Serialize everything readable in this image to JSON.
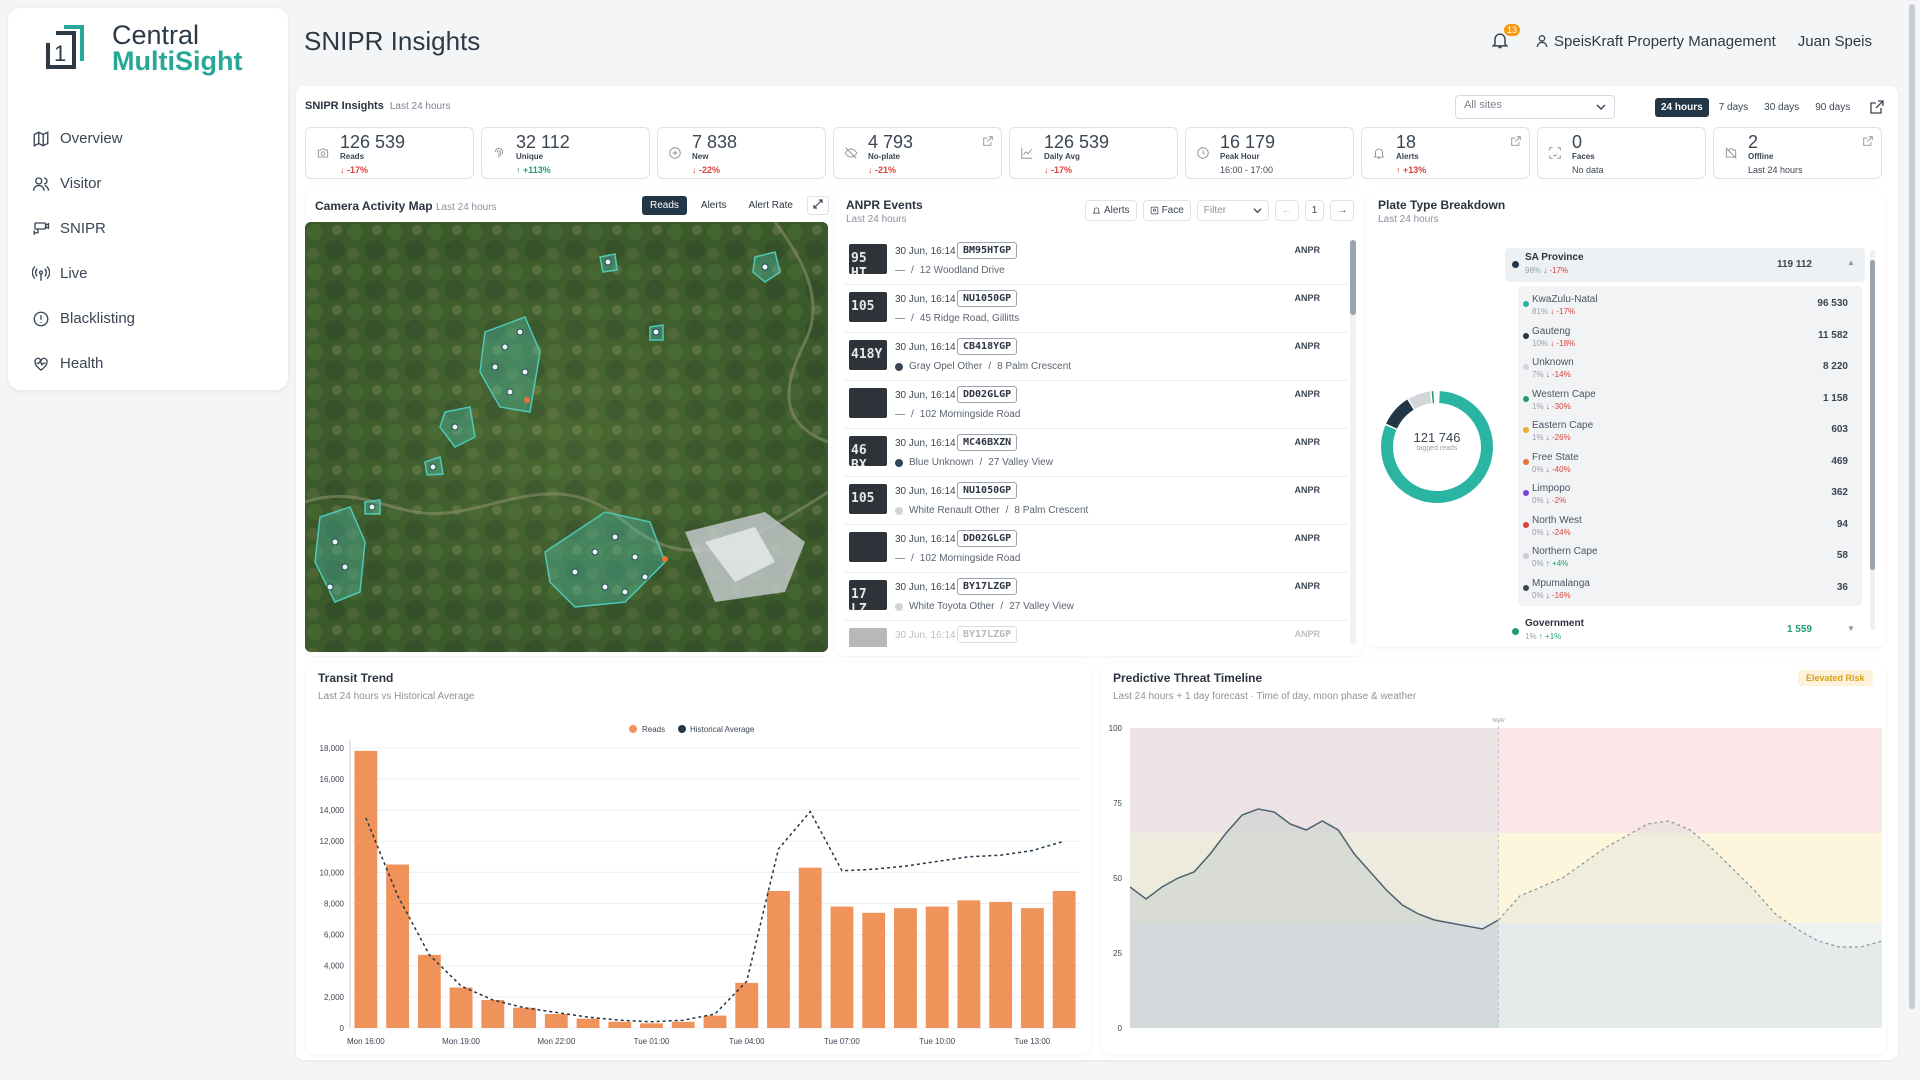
{
  "brand": {
    "line1": "Central",
    "line2": "MultiSight",
    "colors": {
      "teal": "#27a896",
      "dark": "#2d3a46"
    }
  },
  "nav": [
    {
      "label": "Overview",
      "icon": "map-icon"
    },
    {
      "label": "Visitor",
      "icon": "users-icon"
    },
    {
      "label": "SNIPR",
      "icon": "camera-icon"
    },
    {
      "label": "Live",
      "icon": "broadcast-icon"
    },
    {
      "label": "Blacklisting",
      "icon": "info-icon"
    },
    {
      "label": "Health",
      "icon": "heart-icon"
    }
  ],
  "page_title": "SNIPR Insights",
  "header": {
    "notifications": "13",
    "org": "SpeisKraft Property Management",
    "user": "Juan Speis"
  },
  "toolbar": {
    "title": "SNIPR Insights",
    "subtitle": "Last 24 hours",
    "site_select": "All sites",
    "ranges": [
      "24 hours",
      "7 days",
      "30 days",
      "90 days"
    ],
    "active_range": "24 hours"
  },
  "kpis": [
    {
      "value": "126 539",
      "label": "Reads",
      "change": "↓ -17%",
      "dir": "down",
      "icon": "camera-icon"
    },
    {
      "value": "32 112",
      "label": "Unique",
      "change": "↑ +113%",
      "dir": "up",
      "icon": "fingerprint-icon"
    },
    {
      "value": "7 838",
      "label": "New",
      "change": "↓ -22%",
      "dir": "down",
      "icon": "plus-circle-icon"
    },
    {
      "value": "4 793",
      "label": "No-plate",
      "change": "↓ -21%",
      "dir": "down",
      "icon": "no-eye-icon"
    },
    {
      "value": "126 539",
      "label": "Daily Avg",
      "change": "↓ -17%",
      "dir": "down",
      "icon": "chart-icon"
    },
    {
      "value": "16 179",
      "label": "Peak Hour",
      "change": "16:00 - 17:00",
      "dir": "neu",
      "icon": "clock-icon"
    },
    {
      "value": "18",
      "label": "Alerts",
      "change": "↑ +13%",
      "dir": "down",
      "icon": "bell-icon"
    },
    {
      "value": "0",
      "label": "Faces",
      "change": "No data",
      "dir": "neu",
      "icon": "face-icon"
    },
    {
      "value": "2",
      "label": "Offline",
      "change": "Last 24 hours",
      "dir": "neu",
      "icon": "camera-off-icon"
    }
  ],
  "map": {
    "title": "Camera Activity Map",
    "subtitle": "Last 24 hours",
    "tabs": [
      "Reads",
      "Alerts",
      "Alert Rate"
    ],
    "active_tab": "Reads"
  },
  "anpr": {
    "title": "ANPR Events",
    "subtitle": "Last 24 hours",
    "alerts_btn": "Alerts",
    "face_btn": "Face",
    "filter": "Filter",
    "page": "1",
    "events": [
      {
        "time": "30 Jun, 16:14",
        "plate": "BM95HTGP",
        "color": "",
        "vehicle": "—",
        "location": "12 Woodland Drive",
        "type": "ANPR",
        "thumb": "95 HT",
        "dot": ""
      },
      {
        "time": "30 Jun, 16:14",
        "plate": "NU1050GP",
        "color": "",
        "vehicle": "—",
        "location": "45 Ridge Road, Gillitts",
        "type": "ANPR",
        "thumb": "105",
        "dot": ""
      },
      {
        "time": "30 Jun, 16:14",
        "plate": "CB418YGP",
        "color": "",
        "vehicle": "Gray Opel Other",
        "location": "8 Palm Crescent",
        "type": "ANPR",
        "thumb": "418Y",
        "dot": "#3b4654"
      },
      {
        "time": "30 Jun, 16:14",
        "plate": "DD02GLGP",
        "color": "",
        "vehicle": "—",
        "location": "102 Morningside Road",
        "type": "ANPR",
        "thumb": "",
        "dot": ""
      },
      {
        "time": "30 Jun, 16:14",
        "plate": "MC46BXZN",
        "color": "",
        "vehicle": "Blue Unknown",
        "location": "27 Valley View",
        "type": "ANPR",
        "thumb": "46 BX",
        "dot": "#2e4658"
      },
      {
        "time": "30 Jun, 16:14",
        "plate": "NU1050GP",
        "color": "",
        "vehicle": "White Renault Other",
        "location": "8 Palm Crescent",
        "type": "ANPR",
        "thumb": "105",
        "dot": "#d0d4d8"
      },
      {
        "time": "30 Jun, 16:14",
        "plate": "DD02GLGP",
        "color": "",
        "vehicle": "—",
        "location": "102 Morningside Road",
        "type": "ANPR",
        "thumb": "",
        "dot": ""
      },
      {
        "time": "30 Jun, 16:14",
        "plate": "BY17LZGP",
        "color": "",
        "vehicle": "White Toyota Other",
        "location": "27 Valley View",
        "type": "ANPR",
        "thumb": "17 LZ",
        "dot": "#d0d4d8"
      },
      {
        "time": "30 Jun, 16:14",
        "plate": "BY17LZGP",
        "color": "",
        "vehicle": "",
        "location": "",
        "type": "ANPR",
        "thumb": "",
        "dot": ""
      }
    ]
  },
  "plate": {
    "title": "Plate Type Breakdown",
    "subtitle": "Last 24 hours",
    "total": "121 746",
    "total_label": "tagged reads",
    "group": {
      "name": "SA Province",
      "pct": "98%",
      "chg": "↓ -17%",
      "value": "119 112"
    },
    "items": [
      {
        "name": "KwaZulu-Natal",
        "pct": "81%",
        "chg": "↓ -17%",
        "dir": "d",
        "value": "96 530",
        "color": "#2ab5a3"
      },
      {
        "name": "Gauteng",
        "pct": "10%",
        "chg": "↓ -18%",
        "dir": "d",
        "value": "11 582",
        "color": "#233646"
      },
      {
        "name": "Unknown",
        "pct": "7%",
        "chg": "↓ -14%",
        "dir": "d",
        "value": "8 220",
        "color": "#d3d6da"
      },
      {
        "name": "Western Cape",
        "pct": "1%",
        "chg": "↓ -30%",
        "dir": "d",
        "value": "1 158",
        "color": "#1f9d6c"
      },
      {
        "name": "Eastern Cape",
        "pct": "1%",
        "chg": "↓ -26%",
        "dir": "d",
        "value": "603",
        "color": "#e8b023"
      },
      {
        "name": "Free State",
        "pct": "0%",
        "chg": "↓ -40%",
        "dir": "d",
        "value": "469",
        "color": "#e8743b"
      },
      {
        "name": "Limpopo",
        "pct": "0%",
        "chg": "↓ -2%",
        "dir": "d",
        "value": "362",
        "color": "#7b3fe4"
      },
      {
        "name": "North West",
        "pct": "0%",
        "chg": "↓ -24%",
        "dir": "d",
        "value": "94",
        "color": "#d9423a"
      },
      {
        "name": "Northern Cape",
        "pct": "0%",
        "chg": "↑ +4%",
        "dir": "u",
        "value": "58",
        "color": "#c9cdd2"
      },
      {
        "name": "Mpumalanga",
        "pct": "0%",
        "chg": "↓ -16%",
        "dir": "d",
        "value": "36",
        "color": "#3b4654"
      }
    ],
    "group2": {
      "name": "Government",
      "pct": "1%",
      "chg": "↑ +1%",
      "value": "1 559"
    }
  },
  "transit": {
    "title": "Transit Trend",
    "subtitle": "Last 24 hours vs Historical Average"
  },
  "threat": {
    "title": "Predictive Threat Timeline",
    "subtitle": "Last 24 hours + 1 day forecast · Time of day, moon phase & weather",
    "badge": "Elevated Risk",
    "now_label": "NOW"
  },
  "chart_data": [
    {
      "type": "bar",
      "title": "Transit Trend",
      "series": [
        {
          "name": "Reads",
          "color": "#f0935a",
          "values": [
            17800,
            10500,
            4700,
            2600,
            1800,
            1300,
            900,
            600,
            400,
            300,
            400,
            800,
            2900,
            8800,
            10300,
            7800,
            7400,
            7700,
            7800,
            8200,
            8100,
            7700,
            8800
          ]
        },
        {
          "name": "Historical Average",
          "color": "#233646",
          "values": [
            13500,
            8500,
            4700,
            2700,
            1800,
            1300,
            1000,
            700,
            500,
            400,
            500,
            900,
            3000,
            11500,
            13900,
            10100,
            10200,
            10400,
            10700,
            11000,
            11100,
            11400,
            12000
          ]
        }
      ],
      "x": [
        "Mon 16:00",
        "",
        "",
        "Mon 19:00",
        "",
        "",
        "Mon 22:00",
        "",
        "",
        "Tue 01:00",
        "",
        "",
        "Tue 04:00",
        "",
        "",
        "Tue 07:00",
        "",
        "",
        "Tue 10:00",
        "",
        "",
        "Tue 13:00",
        ""
      ],
      "yticks": [
        "0",
        "2,000",
        "4,000",
        "6,000",
        "8,000",
        "10,000",
        "12,000",
        "14,000",
        "16,000",
        "18,000"
      ],
      "ylim": [
        0,
        18500
      ],
      "legend": "top-center"
    },
    {
      "type": "area",
      "title": "Predictive Threat Timeline",
      "ylim": [
        0,
        100
      ],
      "yticks": [
        "0",
        "25",
        "50",
        "75",
        "100"
      ],
      "series": [
        {
          "name": "",
          "values": [
            47,
            43,
            47,
            50,
            52,
            58,
            65,
            71,
            73,
            72,
            68,
            66,
            69,
            66,
            58,
            52,
            46,
            41,
            38,
            36,
            35,
            34,
            33,
            36
          ]
        },
        {
          "name": "",
          "values": [
            36,
            44,
            47,
            50,
            55,
            60,
            64,
            68,
            69,
            66,
            60,
            53,
            46,
            38,
            33,
            29,
            27,
            27,
            29
          ]
        }
      ]
    }
  ]
}
